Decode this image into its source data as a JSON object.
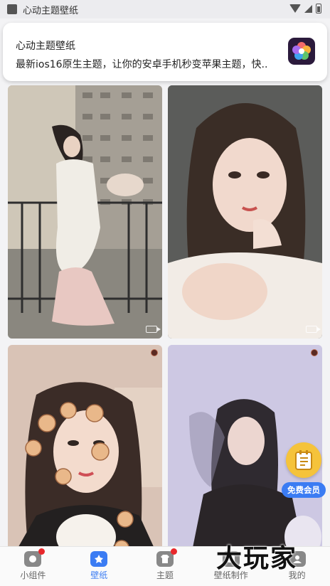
{
  "status_bar": {
    "app_name": "心动主题壁纸"
  },
  "notification": {
    "title": "心动主题壁纸",
    "body": "最新ios16原生主题，让你的安卓手机秒变苹果主题，快.."
  },
  "feed": {
    "cards": [
      {
        "name": "wallpaper-card-1",
        "type": "video",
        "palette": "balcony"
      },
      {
        "name": "wallpaper-card-2",
        "type": "video",
        "palette": "portrait"
      },
      {
        "name": "wallpaper-card-3",
        "type": "image",
        "palette": "bears"
      },
      {
        "name": "wallpaper-card-4",
        "type": "image",
        "palette": "lavender"
      }
    ]
  },
  "vip_float": {
    "label": "免费会员",
    "icon": "notepad-icon",
    "color": "#f5c33b",
    "label_bg": "#3b7cf3"
  },
  "watermark": {
    "text": "大玩家"
  },
  "nav": {
    "items": [
      {
        "label": "小组件",
        "icon": "widget-icon",
        "active": false,
        "badge": true
      },
      {
        "label": "壁纸",
        "icon": "wallpaper-icon",
        "active": true,
        "badge": false
      },
      {
        "label": "主题",
        "icon": "theme-shirt-icon",
        "active": false,
        "badge": true
      },
      {
        "label": "壁纸制作",
        "icon": "wallpaper-make-icon",
        "active": false,
        "badge": false
      },
      {
        "label": "我的",
        "icon": "profile-icon",
        "active": false,
        "badge": false
      }
    ],
    "active_color": "#3b7cf3",
    "badge_color": "#e8272b"
  }
}
